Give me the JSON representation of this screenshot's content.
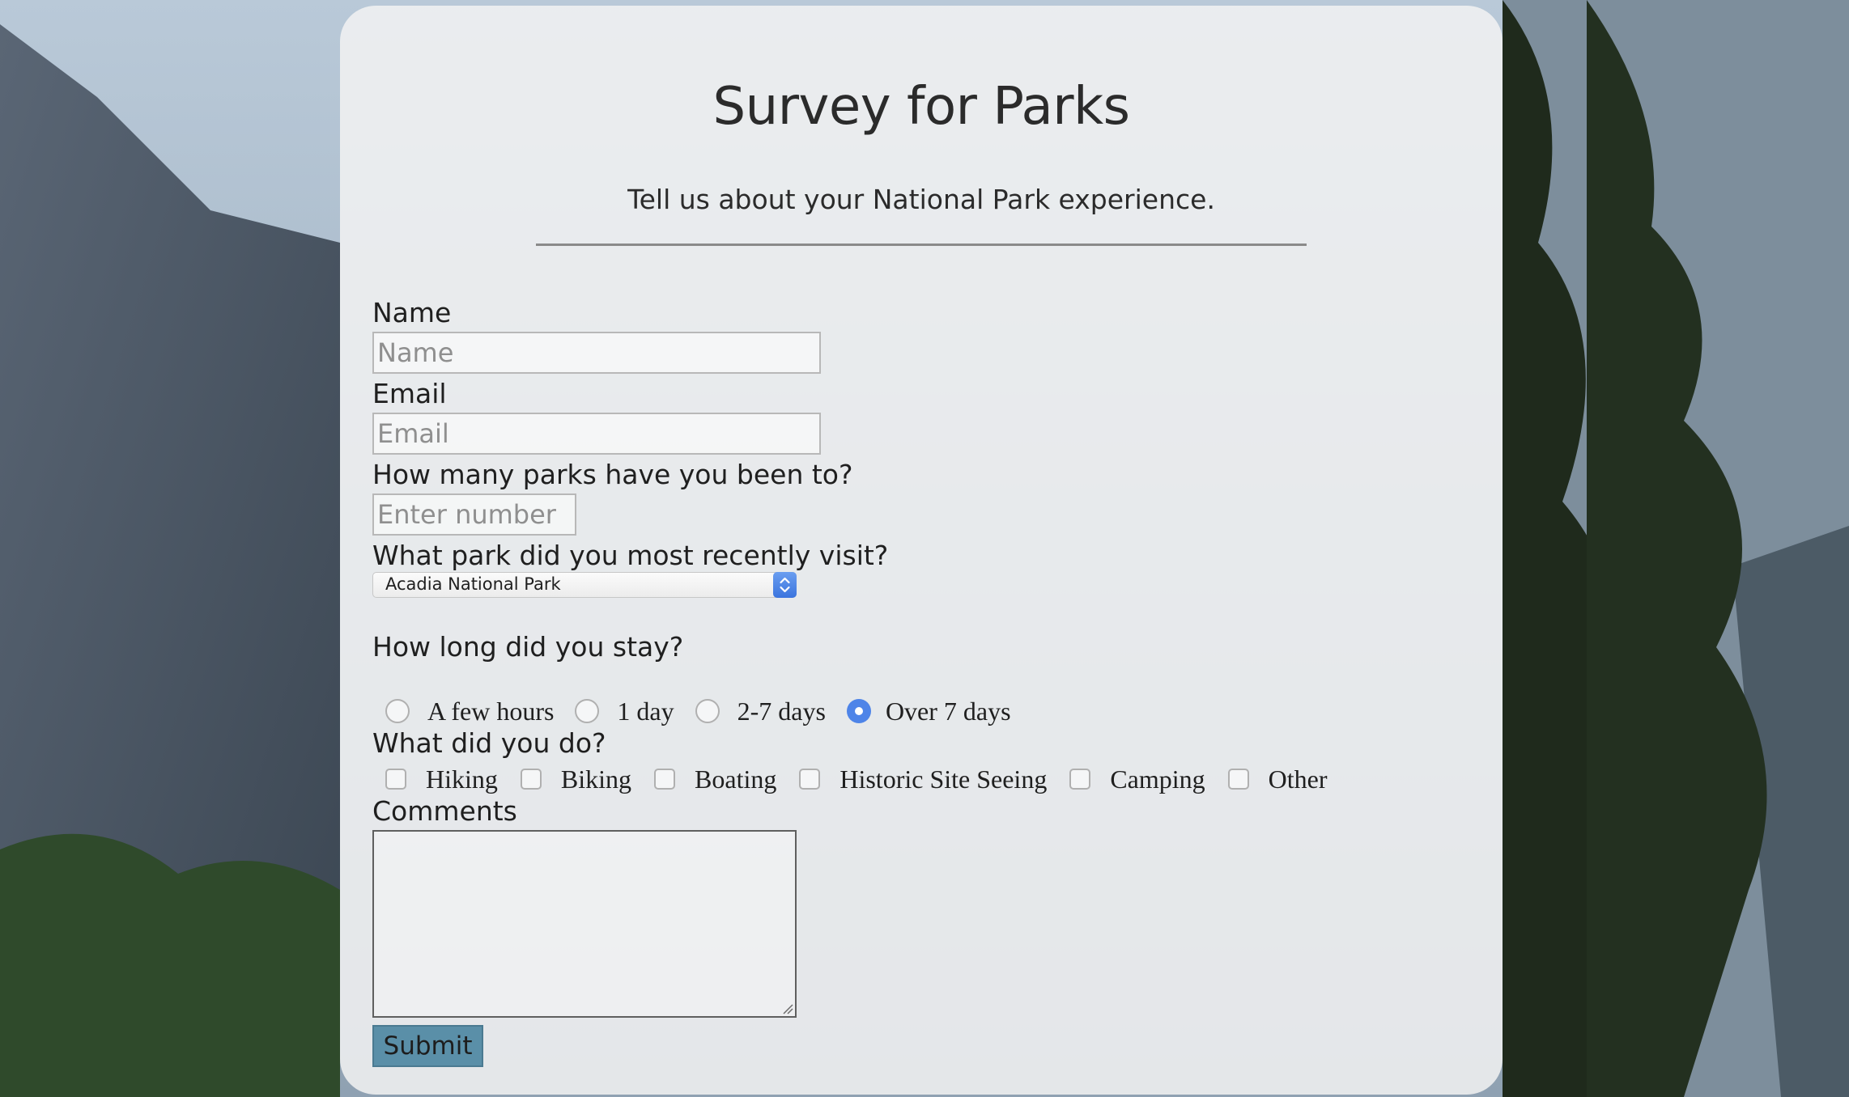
{
  "survey": {
    "title": "Survey for Parks",
    "description": "Tell us about your National Park experience."
  },
  "fields": {
    "name": {
      "label": "Name",
      "placeholder": "Name",
      "value": ""
    },
    "email": {
      "label": "Email",
      "placeholder": "Email",
      "value": ""
    },
    "parks_count": {
      "label": "How many parks have you been to?",
      "placeholder": "Enter number",
      "value": ""
    },
    "recent_park": {
      "label": "What park did you most recently visit?",
      "selected": "Acadia National Park"
    },
    "stay_length": {
      "label": "How long did you stay?",
      "options": [
        "A few hours",
        "1 day",
        "2-7 days",
        "Over 7 days"
      ],
      "selected": "Over 7 days"
    },
    "activities": {
      "label": "What did you do?",
      "options": [
        "Hiking",
        "Biking",
        "Boating",
        "Historic Site Seeing",
        "Camping",
        "Other"
      ],
      "checked": []
    },
    "comments": {
      "label": "Comments",
      "value": ""
    }
  },
  "submit_label": "Submit",
  "colors": {
    "card_background": "#f2f2f2",
    "radio_selected": "#4e84e8",
    "submit_button": "#5a8fa8",
    "select_arrow": "#3b74de"
  },
  "icons": [
    "chevron-up-down-icon",
    "resize-grip-icon"
  ]
}
